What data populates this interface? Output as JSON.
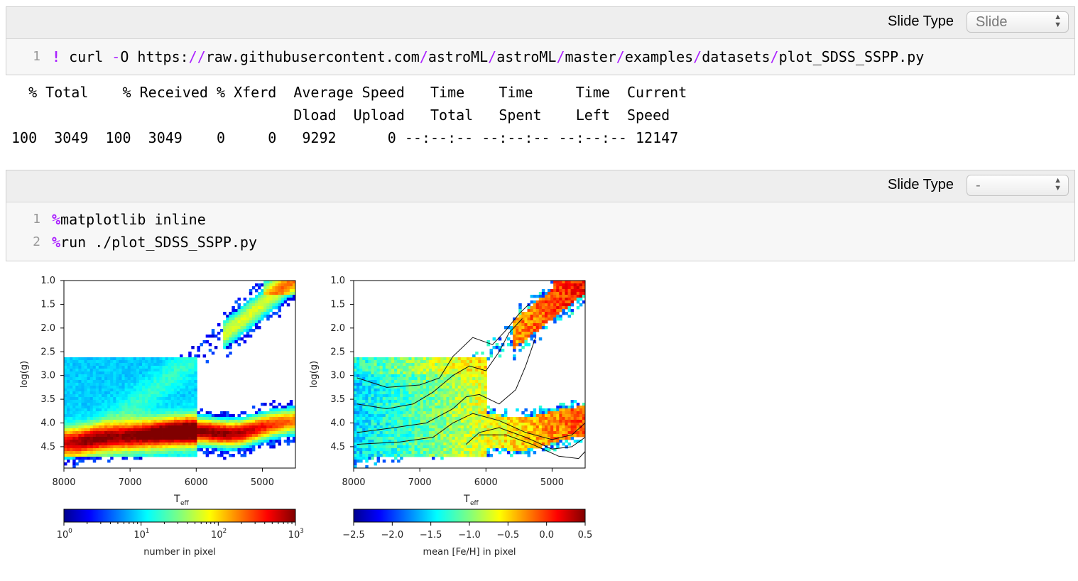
{
  "cell1": {
    "slide_label": "Slide Type",
    "slide_value": "Slide",
    "line_no": "1",
    "cmd_bang": "!",
    "cmd_curl": " curl ",
    "cmd_flag": "-",
    "cmd_flag_letter": "O https:",
    "url_parts": [
      "//",
      "raw.githubusercontent.com",
      "/",
      "astroML",
      "/",
      "astroML",
      "/",
      "master",
      "/",
      "examples",
      "/",
      "datasets",
      "/",
      "plot_SDSS_SSPP.py"
    ]
  },
  "output1": {
    "header1": "  % Total    % Received % Xferd  Average Speed   Time    Time     Time  Current",
    "header2": "                                 Dload  Upload   Total   Spent    Left  Speed",
    "row": "100  3049  100  3049    0     0   9292      0 --:--:-- --:--:-- --:--:-- 12147"
  },
  "cell2": {
    "slide_label": "Slide Type",
    "slide_value": "-",
    "lines": [
      {
        "no": "1",
        "magic": "%",
        "text": "matplotlib inline"
      },
      {
        "no": "2",
        "magic": "%",
        "text": "run ./plot_SDSS_SSPP.py"
      }
    ]
  },
  "icons": {
    "select_arrows": "updown-arrows-icon"
  },
  "chart_data": [
    {
      "type": "heatmap",
      "xlabel": "T",
      "xlabel_sub": "eff",
      "ylabel": "log(g)",
      "x_ticks": [
        "8000",
        "7000",
        "6000",
        "5000"
      ],
      "x_tick_values": [
        8000,
        7000,
        6000,
        5000
      ],
      "y_ticks": [
        "1.0",
        "1.5",
        "2.0",
        "2.5",
        "3.0",
        "3.5",
        "4.0",
        "4.5"
      ],
      "y_tick_values": [
        1.0,
        1.5,
        2.0,
        2.5,
        3.0,
        3.5,
        4.0,
        4.5
      ],
      "xlim": [
        8000,
        4500
      ],
      "ylim": [
        4.95,
        1.0
      ],
      "colorbar": {
        "label": "number in pixel",
        "scale": "log",
        "range": [
          1,
          1000
        ],
        "ticks": [
          "10",
          "10",
          "10",
          "10"
        ],
        "tick_exp": [
          "0",
          "1",
          "2",
          "3"
        ]
      },
      "colormap": "jet"
    },
    {
      "type": "heatmap",
      "xlabel": "T",
      "xlabel_sub": "eff",
      "ylabel": "log(g)",
      "x_ticks": [
        "8000",
        "7000",
        "6000",
        "5000"
      ],
      "x_tick_values": [
        8000,
        7000,
        6000,
        5000
      ],
      "y_ticks": [
        "1.0",
        "1.5",
        "2.0",
        "2.5",
        "3.0",
        "3.5",
        "4.0",
        "4.5"
      ],
      "y_tick_values": [
        1.0,
        1.5,
        2.0,
        2.5,
        3.0,
        3.5,
        4.0,
        4.5
      ],
      "xlim": [
        8000,
        4500
      ],
      "ylim": [
        4.95,
        1.0
      ],
      "contours": true,
      "colorbar": {
        "label": "mean [Fe/H] in pixel",
        "scale": "linear",
        "range": [
          -2.5,
          0.5
        ],
        "ticks": [
          "−2.5",
          "−2.0",
          "−1.5",
          "−1.0",
          "−0.5",
          "0.0",
          "0.5"
        ],
        "tick_values": [
          -2.5,
          -2.0,
          -1.5,
          -1.0,
          -0.5,
          0.0,
          0.5
        ]
      },
      "colormap": "jet"
    }
  ]
}
